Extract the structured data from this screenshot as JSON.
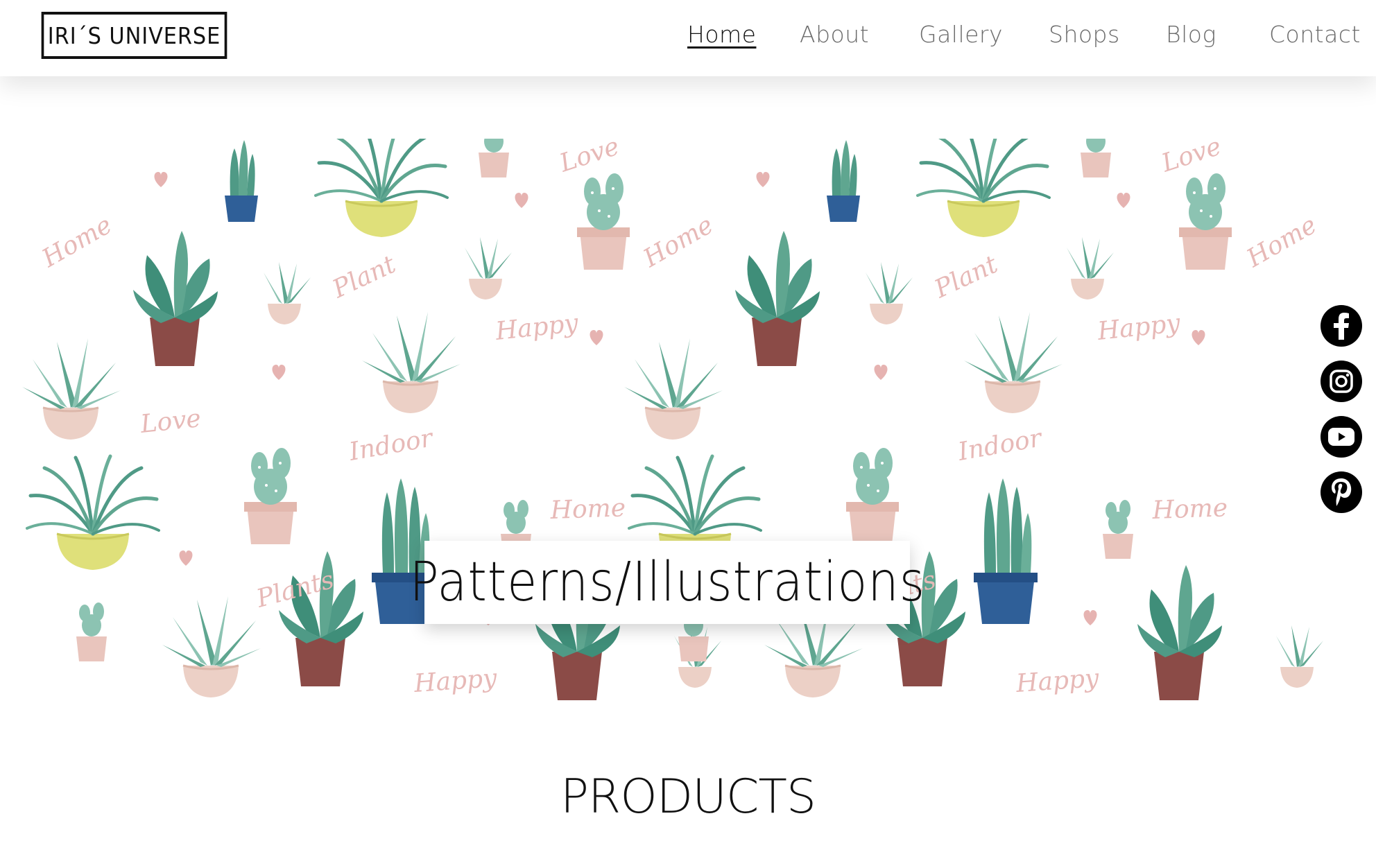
{
  "brand": {
    "logo_text": "IRI´S UNIVERSE"
  },
  "nav": {
    "items": [
      {
        "label": "Home",
        "active": true
      },
      {
        "label": "About",
        "active": false
      },
      {
        "label": "Gallery",
        "active": false
      },
      {
        "label": "Shops",
        "active": false
      },
      {
        "label": "Blog",
        "active": false
      },
      {
        "label": "Contact",
        "active": false
      }
    ]
  },
  "hero": {
    "title": "Patterns/Illustrations",
    "pattern_words": [
      "Love",
      "Home",
      "Plant",
      "Happy",
      "Indoor",
      "Plants"
    ]
  },
  "social": {
    "icons": [
      "facebook-icon",
      "instagram-icon",
      "youtube-icon",
      "pinterest-icon"
    ]
  },
  "section": {
    "products_heading": "PRODUCTS"
  },
  "colors": {
    "leaf": "#4f9a86",
    "leaf_light": "#8cc3b2",
    "pot_pink": "#e9c5bd",
    "pot_blue": "#2f5f98",
    "pot_yellow": "#dfe07a",
    "pot_brown": "#8b4b47",
    "script": "#e7b9b7"
  }
}
